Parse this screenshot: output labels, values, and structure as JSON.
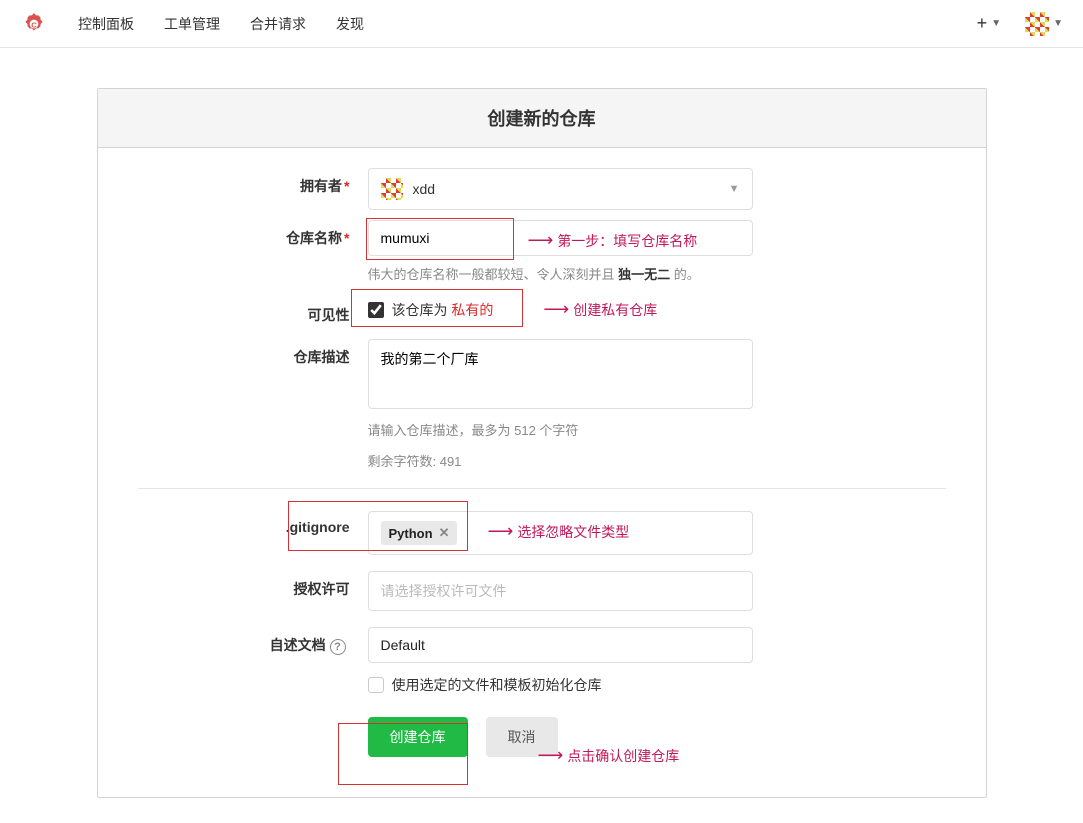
{
  "nav": {
    "dashboard": "控制面板",
    "issues": "工单管理",
    "pulls": "合并请求",
    "explore": "发现"
  },
  "header": {
    "title": "创建新的仓库"
  },
  "form": {
    "owner": {
      "label": "拥有者",
      "value": "xdd"
    },
    "repo_name": {
      "label": "仓库名称",
      "value": "mumuxi",
      "help_prefix": "伟大的仓库名称一般都较短、令人深刻并且 ",
      "help_bold": "独一无二",
      "help_suffix": " 的。"
    },
    "visibility": {
      "label": "可见性",
      "text_prefix": "该仓库为 ",
      "text_private": "私有的"
    },
    "desc": {
      "label": "仓库描述",
      "value": "我的第二个厂库",
      "help": "请输入仓库描述，最多为 512 个字符",
      "remaining": "剩余字符数: 491"
    },
    "gitignore": {
      "label": ".gitignore",
      "value": "Python"
    },
    "license": {
      "label": "授权许可",
      "placeholder": "请选择授权许可文件"
    },
    "readme": {
      "label": "自述文档",
      "value": "Default",
      "init_label": "使用选定的文件和模板初始化仓库"
    },
    "submit": "创建仓库",
    "cancel": "取消"
  },
  "annotations": {
    "step1": "第一步：填写仓库名称",
    "private_note": "创建私有仓库",
    "gitignore_note": "选择忽略文件类型",
    "confirm": "点击确认创建仓库"
  }
}
